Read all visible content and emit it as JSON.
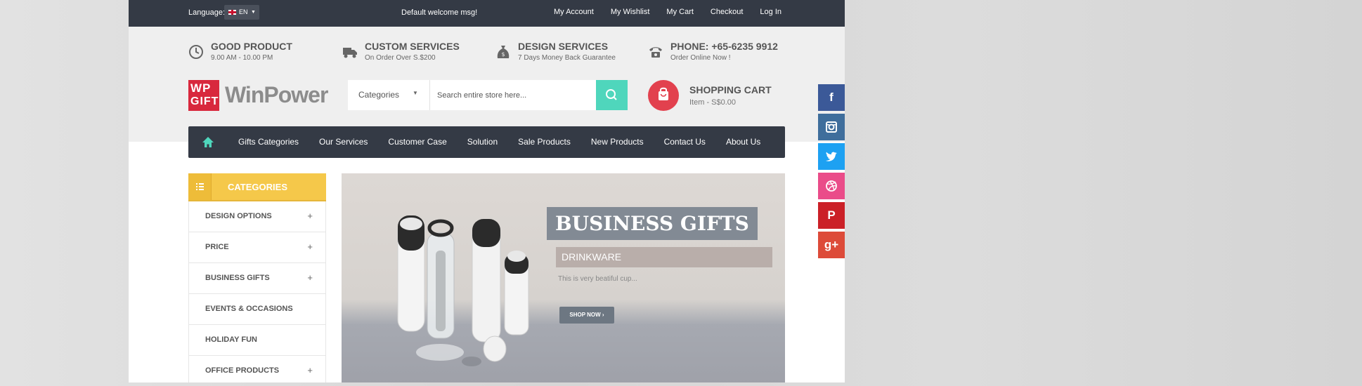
{
  "topbar": {
    "language_label": "Language:",
    "language_code": "EN",
    "welcome": "Default welcome msg!",
    "links": [
      "My Account",
      "My Wishlist",
      "My Cart",
      "Checkout",
      "Log In"
    ]
  },
  "info": [
    {
      "title": "GOOD PRODUCT",
      "sub": "9.00 AM - 10.00 PM",
      "icon": "clock-icon"
    },
    {
      "title": "CUSTOM SERVICES",
      "sub": "On Order Over S.$200",
      "icon": "truck-icon"
    },
    {
      "title": "DESIGN SERVICES",
      "sub": "7 Days Money Back Guarantee",
      "icon": "money-bag-icon"
    },
    {
      "title": "PHONE: +65-6235 9912",
      "sub": "Order Online Now !",
      "icon": "phone-icon"
    }
  ],
  "logo": {
    "badge_line1": "WP",
    "badge_line2": "GIFT",
    "text": "WinPower"
  },
  "search": {
    "category": "Categories",
    "placeholder": "Search entire store here..."
  },
  "cart": {
    "title": "SHOPPING CART",
    "summary": "Item - S$0.00"
  },
  "nav": {
    "items": [
      "Gifts Categories",
      "Our Services",
      "Customer Case",
      "Solution",
      "Sale Products",
      "New Products",
      "Contact Us",
      "About Us"
    ]
  },
  "categories": {
    "title": "CATEGORIES",
    "items": [
      {
        "label": "DESIGN OPTIONS",
        "expand": "+"
      },
      {
        "label": "PRICE",
        "expand": "+"
      },
      {
        "label": "BUSINESS GIFTS",
        "expand": "+"
      },
      {
        "label": "EVENTS & OCCASIONS",
        "expand": ""
      },
      {
        "label": "HOLIDAY FUN",
        "expand": ""
      },
      {
        "label": "OFFICE PRODUCTS",
        "expand": "+"
      }
    ]
  },
  "banner": {
    "title": "BUSINESS GIFTS",
    "subtitle": "DRINKWARE",
    "description": "This is very beatiful cup...",
    "button": "SHOP NOW ›"
  },
  "social": {
    "facebook_glyph": "f",
    "instagram_glyph": "",
    "twitter_glyph": "",
    "dribbble_glyph": "",
    "pinterest_glyph": "P",
    "googleplus_glyph": "g+",
    "colors": {
      "facebook": "#3b5998",
      "instagram": "#3f6e9c",
      "twitter": "#1da1f2",
      "dribbble": "#ea4c89",
      "pinterest": "#cb2027",
      "googleplus": "#dd4b39"
    }
  },
  "colors": {
    "topbar": "#343a45",
    "accent_teal": "#4fd6bc",
    "accent_yellow": "#f5c84a",
    "cart_red": "#e2414e",
    "logo_red": "#d8283d"
  }
}
